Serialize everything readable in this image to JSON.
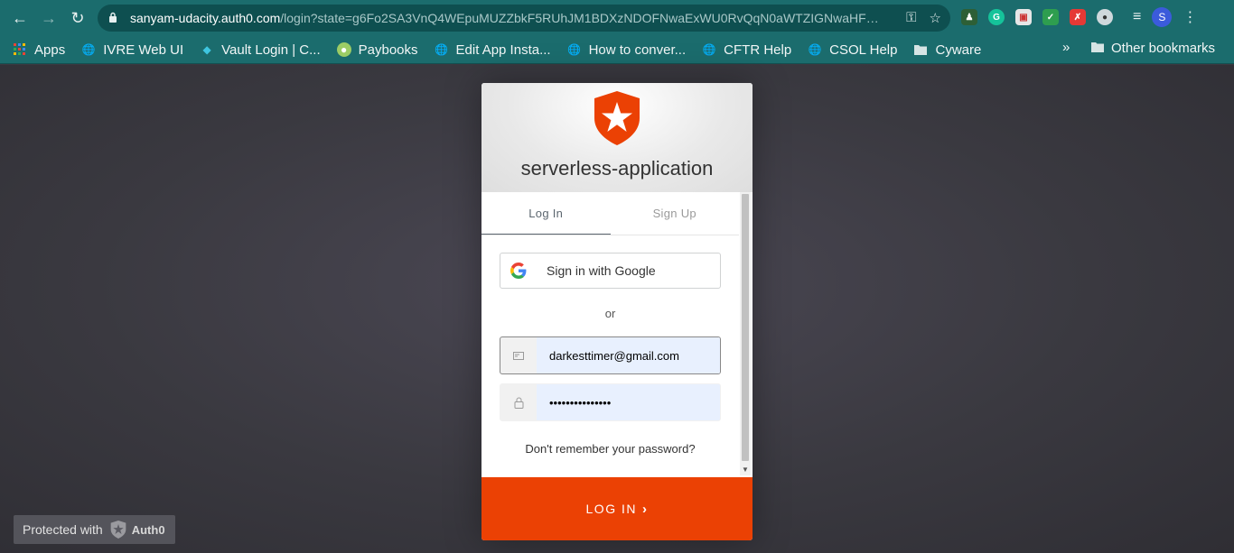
{
  "browser": {
    "url_host": "sanyam-udacity.auth0.com",
    "url_path": "/login?state=g6Fo2SA3VnQ4WEpuMUZZbkF5RUhJM1BDXzNDOFNwaExWU0RvQqN0aWTZIGNwaHFVc...",
    "profile_initial": "S"
  },
  "bookmarks": {
    "items": [
      {
        "label": "Apps",
        "icon": "apps-grid-icon"
      },
      {
        "label": "IVRE Web UI",
        "icon": "globe-icon"
      },
      {
        "label": "Vault Login | C...",
        "icon": "vault-icon"
      },
      {
        "label": "Paybooks",
        "icon": "paybooks-icon"
      },
      {
        "label": "Edit App Insta...",
        "icon": "globe-icon"
      },
      {
        "label": "How to conver...",
        "icon": "globe-icon"
      },
      {
        "label": "CFTR Help",
        "icon": "globe-icon"
      },
      {
        "label": "CSOL Help",
        "icon": "globe-icon"
      },
      {
        "label": "Cyware",
        "icon": "folder-icon"
      }
    ],
    "more": "»",
    "other": "Other bookmarks"
  },
  "auth": {
    "app_name": "serverless-application",
    "tabs": {
      "login": "Log In",
      "signup": "Sign Up"
    },
    "google_button": "Sign in with Google",
    "or_text": "or",
    "email_value": "darkesttimer@gmail.com",
    "password_value": "•••••••••••••••",
    "forgot_password": "Don't remember your password?",
    "submit_label": "LOG IN",
    "submit_chevron": "›"
  },
  "badge": {
    "protected_text": "Protected with",
    "brand": "Auth0"
  },
  "colors": {
    "browser_frame": "#1b6c6d",
    "accent": "#eb4104",
    "input_fill": "#e8f0fe"
  }
}
